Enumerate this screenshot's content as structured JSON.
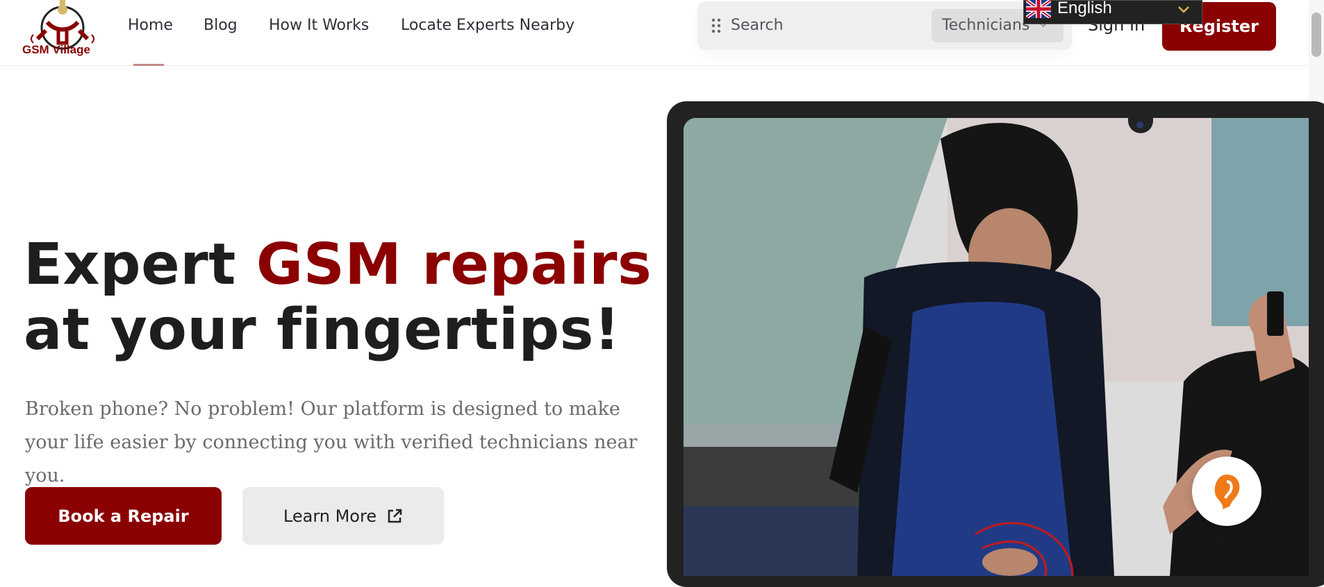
{
  "header": {
    "logo_text": "GSM Village",
    "nav": [
      {
        "label": "Home"
      },
      {
        "label": "Blog"
      },
      {
        "label": "How It Works"
      },
      {
        "label": "Locate Experts Nearby"
      }
    ],
    "search": {
      "placeholder": "Search",
      "category_selected": "Technicians"
    },
    "language": "English",
    "signin_label": "Sign In",
    "register_label": "Register"
  },
  "hero": {
    "title_part1": "Expert ",
    "title_accent": "GSM repairs",
    "title_part2": " at your fingertips!",
    "subtitle": "Broken phone? No problem! Our platform is designed to make your life easier by connecting you with verified technicians near you.",
    "primary_button": "Book a Repair",
    "secondary_button": "Learn More"
  },
  "colors": {
    "brand": "#8b0000",
    "text_dark": "#1e1e1e",
    "muted": "#6b6b6b",
    "chat_accent": "#f07a1a"
  },
  "icons": {
    "search_grip": "drag-dots-icon",
    "category_dropdown": "chevron-down-icon",
    "language_flag": "uk-flag-icon",
    "learn_more": "external-link-icon",
    "chat": "chat-assistant-icon"
  }
}
